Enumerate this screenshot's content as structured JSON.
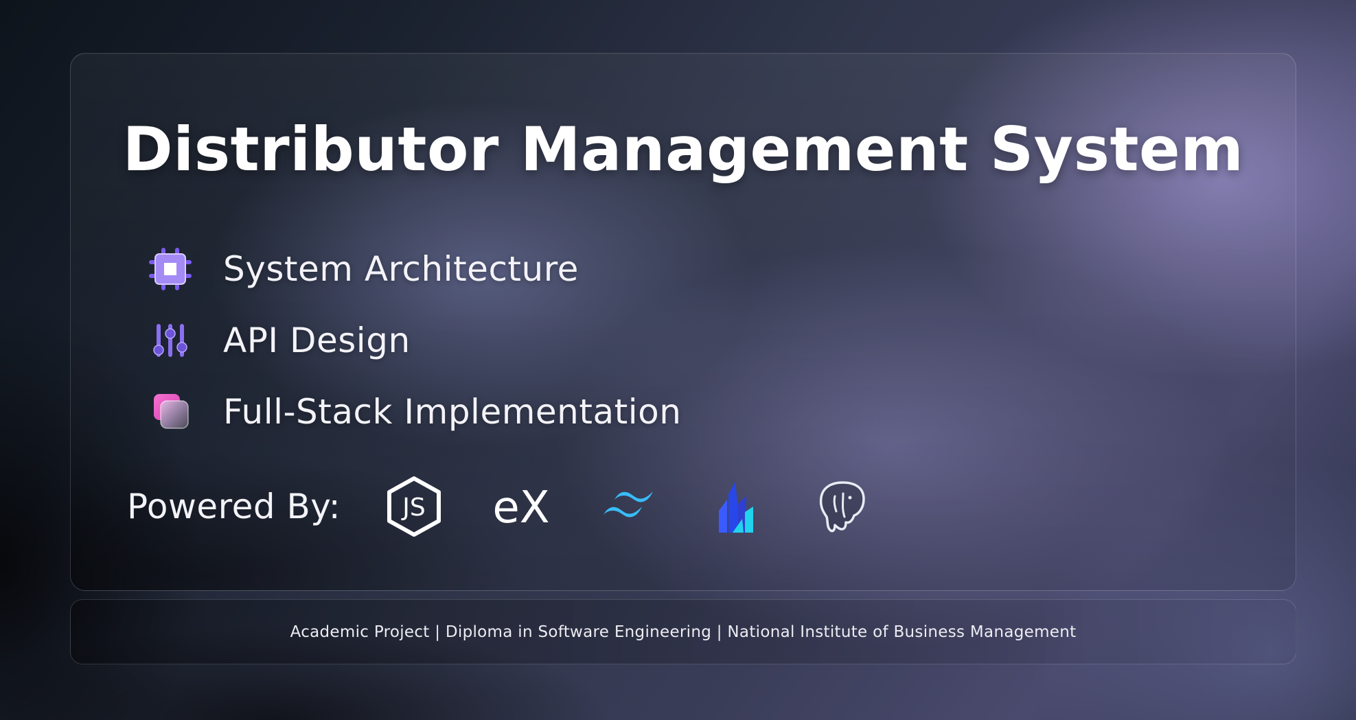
{
  "title": "Distributor Management System",
  "features": [
    {
      "label": "System Architecture",
      "icon": "chip-icon"
    },
    {
      "label": "API Design",
      "icon": "sliders-icon"
    },
    {
      "label": "Full-Stack Implementation",
      "icon": "layers-icon"
    }
  ],
  "powered_by": {
    "label": "Powered By:",
    "technologies": [
      {
        "icon": "nodejs-icon"
      },
      {
        "icon": "express-icon",
        "text": "eX"
      },
      {
        "icon": "tailwind-icon"
      },
      {
        "icon": "drizzle-icon"
      },
      {
        "icon": "postgresql-icon"
      }
    ]
  },
  "footer": {
    "text": "Academic Project | Diploma in Software Engineering | National Institute of Business Management"
  },
  "colors": {
    "accent_purple": "#7b5cf0",
    "accent_pink": "#e25bc8",
    "tailwind_cyan": "#38bdf8",
    "drizzle_blue": "#3b5bff"
  }
}
